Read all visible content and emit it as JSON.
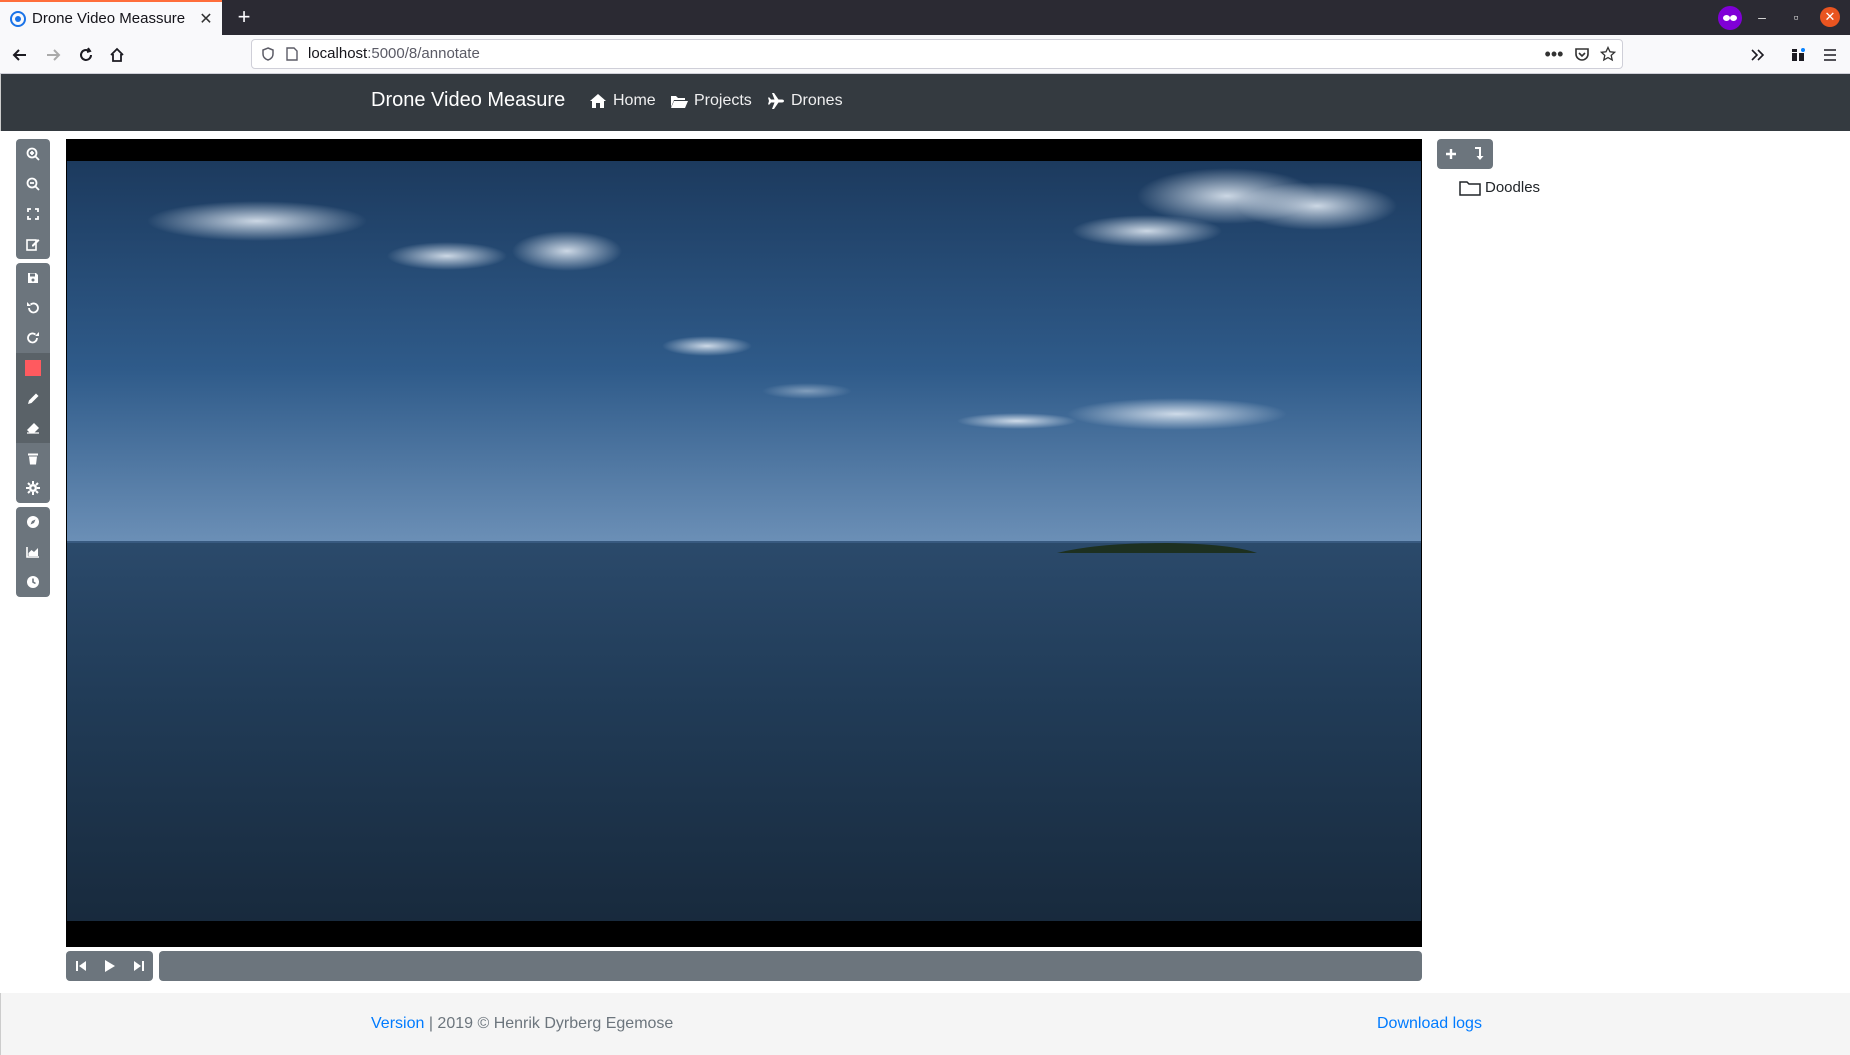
{
  "browser": {
    "tab_title": "Drone Video Meassure",
    "url_host": "localhost",
    "url_path": ":5000/8/annotate"
  },
  "app": {
    "brand": "Drone Video Measure",
    "nav": [
      {
        "label": "Home",
        "icon": "home-icon"
      },
      {
        "label": "Projects",
        "icon": "folder-open-icon"
      },
      {
        "label": "Drones",
        "icon": "plane-icon"
      }
    ]
  },
  "toolbar": {
    "groups": [
      [
        "zoom-in-icon",
        "zoom-out-icon",
        "fullscreen-icon",
        "edit-icon"
      ],
      [
        "save-icon",
        "undo-icon",
        "redo-icon",
        "color-swatch",
        "pencil-icon",
        "eraser-icon",
        "trash-icon",
        "settings-icon"
      ],
      [
        "compass-icon",
        "chart-icon",
        "clock-icon"
      ]
    ],
    "color": "#ff5a5f"
  },
  "player": {
    "buttons": [
      "step-back-icon",
      "play-icon",
      "step-forward-icon"
    ],
    "progress": 0
  },
  "panel": {
    "buttons": [
      "add-icon",
      "import-icon"
    ],
    "tree": [
      {
        "label": "Doodles",
        "icon": "folder-icon"
      }
    ]
  },
  "footer": {
    "version_link": "Version",
    "copyright": " | 2019 © Henrik Dyrberg Egemose",
    "download_link": "Download logs"
  },
  "colors": {
    "navbar": "#343a40",
    "toolbar": "#6c757d",
    "link": "#007bff"
  }
}
